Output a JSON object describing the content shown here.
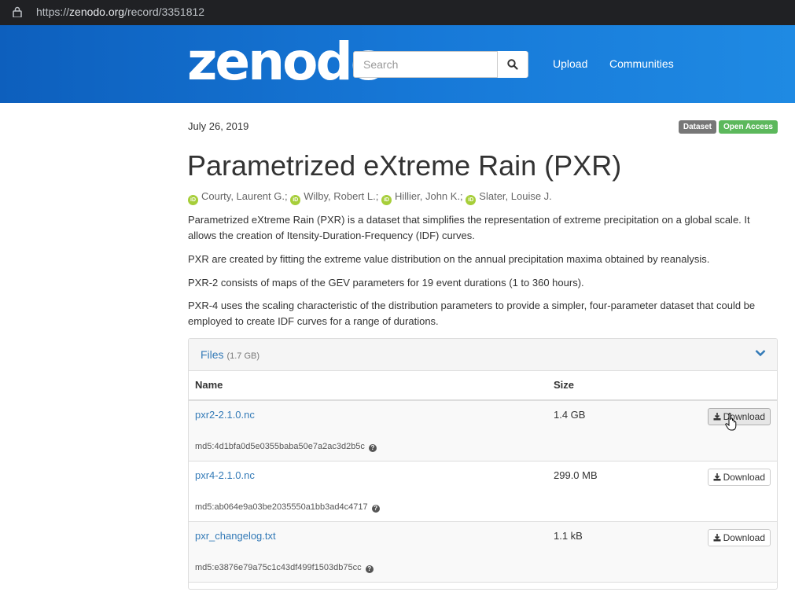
{
  "browser": {
    "url_prefix": "https://",
    "url_host": "zenodo.org",
    "url_path": "/record/3351812"
  },
  "header": {
    "logo": "zenodo",
    "search_placeholder": "Search",
    "nav": [
      "Upload",
      "Communities"
    ]
  },
  "record": {
    "date": "July 26, 2019",
    "badges": [
      "Dataset",
      "Open Access"
    ],
    "title": "Parametrized eXtreme Rain (PXR)",
    "authors": [
      "Courty, Laurent G.;",
      "Wilby, Robert L.;",
      "Hillier, John K.;",
      "Slater, Louise J."
    ],
    "description": [
      "Parametrized eXtreme Rain (PXR) is a dataset that simplifies the representation of extreme precipitation on a global scale. It allows the creation of Itensity-Duration-Frequency (IDF) curves.",
      "PXR are created by fitting the extreme value distribution on the annual precipitation maxima obtained by reanalysis.",
      "PXR-2 consists of maps of the GEV parameters for 19 event durations (1 to 360 hours).",
      "PXR-4 uses the scaling characteristic of the distribution parameters to provide a simpler, four-parameter dataset that could be employed to create IDF curves for a range of durations."
    ]
  },
  "files": {
    "label": "Files",
    "total_size": "(1.7 GB)",
    "columns": [
      "Name",
      "Size"
    ],
    "download_label": "Download",
    "rows": [
      {
        "name": "pxr2-2.1.0.nc",
        "size": "1.4 GB",
        "md5": "md5:4d1bfa0d5e0355baba50e7a2ac3d2b5c"
      },
      {
        "name": "pxr4-2.1.0.nc",
        "size": "299.0 MB",
        "md5": "md5:ab064e9a03be2035550a1bb3ad4c4717"
      },
      {
        "name": "pxr_changelog.txt",
        "size": "1.1 kB",
        "md5": "md5:e3876e79a75c1c43df499f1503db75cc"
      }
    ]
  }
}
